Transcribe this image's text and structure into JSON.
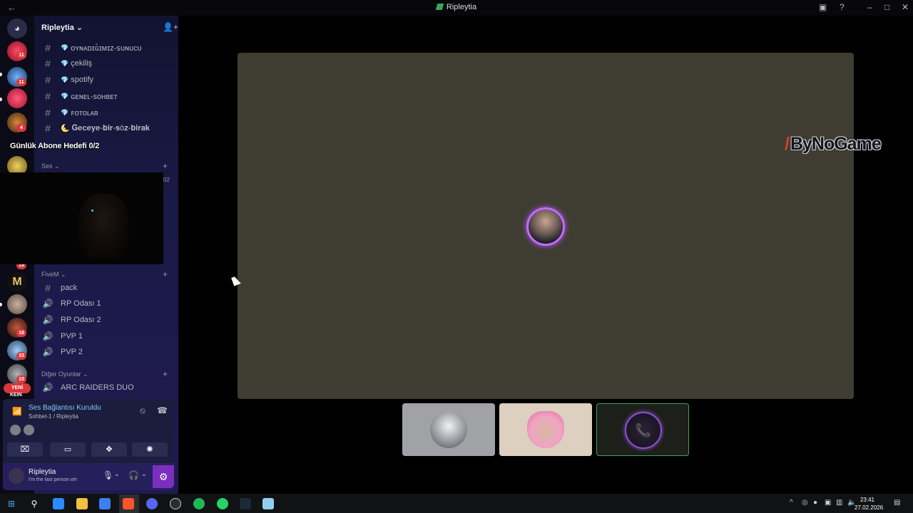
{
  "window": {
    "title": "Ripleytia"
  },
  "rail": {
    "badges": [
      "11",
      "11",
      "4",
      "19",
      "18",
      "33",
      "10"
    ],
    "new_label": "YENİ",
    "new_sub": "KEIN"
  },
  "server": {
    "name": "Ripleytia"
  },
  "channels_top": [
    {
      "prefix": "💎",
      "name": "ᴏʏɴᴀᴅɪɢ̆ɪᴍɪᴢ-ꜱᴜɴᴜᴄᴜ"
    },
    {
      "prefix": "💎",
      "name": "çekiliş"
    },
    {
      "prefix": "💎",
      "name": "spotify"
    },
    {
      "prefix": "💎",
      "name": "ɢᴇɴᴇʟ-ꜱᴏʜʙᴇᴛ"
    },
    {
      "prefix": "💎",
      "name": "ꜰᴏᴛᴏʟᴀʀ"
    },
    {
      "prefix": "🌜",
      "name": "𝐆𝐞𝐜𝐞𝐲𝐞-𝐛𝐢𝐫-𝐬ö𝐳-𝐛𝐢𝐫𝐚𝐤"
    }
  ],
  "overlay_text": "Günlük Abone Hedefi 0/2",
  "categories": {
    "ses": "Ses",
    "fivem": "FiveM",
    "diger": "Diğer Oyunlar"
  },
  "ses_partial": "02",
  "fivem_channels": [
    {
      "kind": "text",
      "name": "pack"
    },
    {
      "kind": "voice",
      "name": "RP Odası 1"
    },
    {
      "kind": "voice",
      "name": "RP Odası 2"
    },
    {
      "kind": "voice",
      "name": "PVP 1"
    },
    {
      "kind": "voice",
      "name": "PVP 2"
    }
  ],
  "diger_channels": [
    {
      "kind": "voice",
      "name": "ARC RAIDERS DUO"
    }
  ],
  "voice": {
    "status": "Ses Bağlantısı Kuruldu",
    "location": "Sohbet-1 / Ripleytia"
  },
  "user": {
    "name": "Ripleytia",
    "status": "I'm the last person wh"
  },
  "brand": {
    "text": "ByNoGame"
  },
  "clock": {
    "time": "23:41",
    "date": "27.02.2026"
  },
  "colors": {
    "accent": "#7b2fbe",
    "speaking_ring": "#c26bff",
    "connected": "#7fc9ff",
    "badge": "#da373c"
  }
}
